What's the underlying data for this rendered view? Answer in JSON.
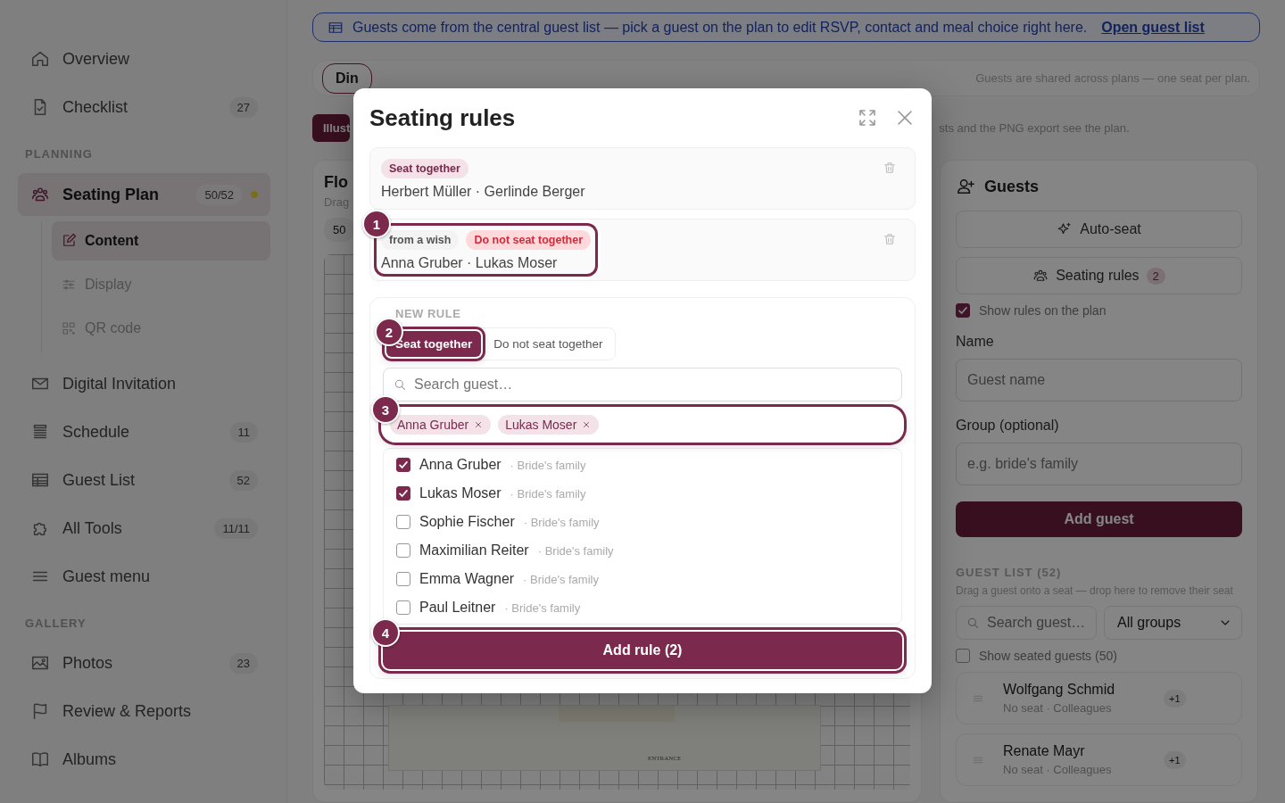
{
  "sidebar": {
    "items": [
      {
        "kind": "link",
        "label": "Overview",
        "selected": false
      },
      {
        "kind": "link",
        "label": "Checklist",
        "badge": "27",
        "selected": false
      },
      {
        "kind": "section",
        "label": "PLANNING"
      },
      {
        "kind": "link",
        "label": "Seating Plan",
        "badge": "50/52",
        "dot": true,
        "selected": true,
        "children": [
          {
            "label": "Content",
            "selected": true
          },
          {
            "label": "Display",
            "selected": false
          },
          {
            "label": "QR code",
            "selected": false
          }
        ]
      },
      {
        "kind": "link",
        "label": "Digital Invitation",
        "selected": false
      },
      {
        "kind": "link",
        "label": "Schedule",
        "badge": "11",
        "selected": false
      },
      {
        "kind": "link",
        "label": "Guest List",
        "badge": "52",
        "selected": false
      },
      {
        "kind": "link",
        "label": "All Tools",
        "badge": "11/11",
        "selected": false
      },
      {
        "kind": "link",
        "label": "Guest menu",
        "selected": false
      },
      {
        "kind": "section",
        "label": "GALLERY"
      },
      {
        "kind": "link",
        "label": "Photos",
        "badge": "23",
        "selected": false
      },
      {
        "kind": "link",
        "label": "Review & Reports",
        "selected": false
      },
      {
        "kind": "link",
        "label": "Albums",
        "selected": false
      }
    ]
  },
  "banner": {
    "text": "Guests come from the central guest list — pick a guest on the plan to edit RSVP, contact and meal choice right here.",
    "link": "Open guest list"
  },
  "plans": {
    "tab": "Din",
    "note": "Guests are shared across plans — one seat per plan."
  },
  "toolbar": {
    "button": "Illust",
    "note": "sts and the PNG export see the plan."
  },
  "floor": {
    "title": "Flo",
    "subtitle": "Drag",
    "count": "50",
    "canvas_label": "ENTRANCE"
  },
  "guests_panel": {
    "title": "Guests",
    "auto_seat": "Auto-seat",
    "rules_button": "Seating rules",
    "rules_count": "2",
    "show_rules": {
      "label": "Show rules on the plan",
      "checked": true
    },
    "name_label": "Name",
    "name_placeholder": "Guest name",
    "group_label": "Group (optional)",
    "group_placeholder": "e.g. bride's family",
    "add_button": "Add guest",
    "list_heading": "GUEST LIST (52)",
    "list_hint": "Drag a guest onto a seat — drop here to remove their seat",
    "search_placeholder": "Search guest…",
    "group_filter": "All groups",
    "show_seated": {
      "label": "Show seated guests (50)",
      "checked": false
    },
    "guests": [
      {
        "name": "Wolfgang Schmid",
        "meta": "No seat · Colleagues",
        "plus": "+1"
      },
      {
        "name": "Renate Mayr",
        "meta": "No seat · Colleagues",
        "plus": "+1"
      }
    ]
  },
  "modal": {
    "title": "Seating rules",
    "rules": [
      {
        "tags": [
          {
            "kind": "together",
            "text": "Seat together"
          }
        ],
        "guests": "Herbert Müller · Gerlinde Berger"
      },
      {
        "callout": "1",
        "tags": [
          {
            "kind": "source",
            "text": "from a wish"
          },
          {
            "kind": "apart",
            "text": "Do not seat together"
          }
        ],
        "guests": "Anna Gruber · Lukas Moser"
      }
    ],
    "new_rule": {
      "heading": "NEW RULE",
      "modes_callout": "2",
      "modes": [
        {
          "label": "Seat together",
          "selected": true
        },
        {
          "label": "Do not seat together",
          "selected": false
        }
      ],
      "search_placeholder": "Search guest…",
      "chips_callout": "3",
      "chips": [
        "Anna Gruber",
        "Lukas Moser"
      ],
      "options": [
        {
          "name": "Anna Gruber",
          "group": "· Bride's family",
          "checked": true
        },
        {
          "name": "Lukas Moser",
          "group": "· Bride's family",
          "checked": true
        },
        {
          "name": "Sophie Fischer",
          "group": "· Bride's family",
          "checked": false
        },
        {
          "name": "Maximilian Reiter",
          "group": "· Bride's family",
          "checked": false
        },
        {
          "name": "Emma Wagner",
          "group": "· Bride's family",
          "checked": false
        },
        {
          "name": "Paul Leitner",
          "group": "· Bride's family",
          "checked": false
        }
      ],
      "add_callout": "4",
      "add_button": "Add rule (2)"
    }
  }
}
